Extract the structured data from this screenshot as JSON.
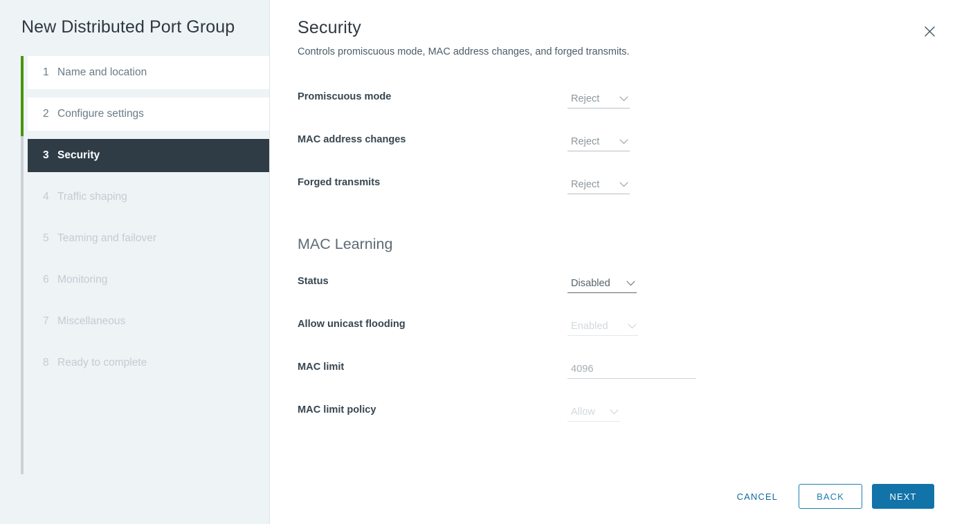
{
  "sidebar": {
    "title": "New Distributed Port Group",
    "steps": [
      {
        "num": "1",
        "label": "Name and location",
        "state": "done"
      },
      {
        "num": "2",
        "label": "Configure settings",
        "state": "done"
      },
      {
        "num": "3",
        "label": "Security",
        "state": "current"
      },
      {
        "num": "4",
        "label": "Traffic shaping",
        "state": "upcoming"
      },
      {
        "num": "5",
        "label": "Teaming and failover",
        "state": "upcoming"
      },
      {
        "num": "6",
        "label": "Monitoring",
        "state": "upcoming"
      },
      {
        "num": "7",
        "label": "Miscellaneous",
        "state": "upcoming"
      },
      {
        "num": "8",
        "label": "Ready to complete",
        "state": "upcoming"
      }
    ]
  },
  "header": {
    "title": "Security",
    "subtitle": "Controls promiscuous mode, MAC address changes, and forged transmits.",
    "close_icon": "close-icon"
  },
  "security": {
    "promiscuous_mode": {
      "label": "Promiscuous mode",
      "value": "Reject"
    },
    "mac_address_changes": {
      "label": "MAC address changes",
      "value": "Reject"
    },
    "forged_transmits": {
      "label": "Forged transmits",
      "value": "Reject"
    }
  },
  "mac_learning": {
    "section_title": "MAC Learning",
    "status": {
      "label": "Status",
      "value": "Disabled"
    },
    "allow_unicast_flooding": {
      "label": "Allow unicast flooding",
      "value": "Enabled"
    },
    "mac_limit": {
      "label": "MAC limit",
      "value": "4096"
    },
    "mac_limit_policy": {
      "label": "MAC limit policy",
      "value": "Allow"
    }
  },
  "footer": {
    "cancel": "CANCEL",
    "back": "BACK",
    "next": "NEXT"
  },
  "colors": {
    "accent_green": "#48960c",
    "current_step_bg": "#2f3c46",
    "primary_blue": "#1273a8",
    "link_blue": "#0f6a9b",
    "sidebar_bg": "#eef3f6"
  }
}
